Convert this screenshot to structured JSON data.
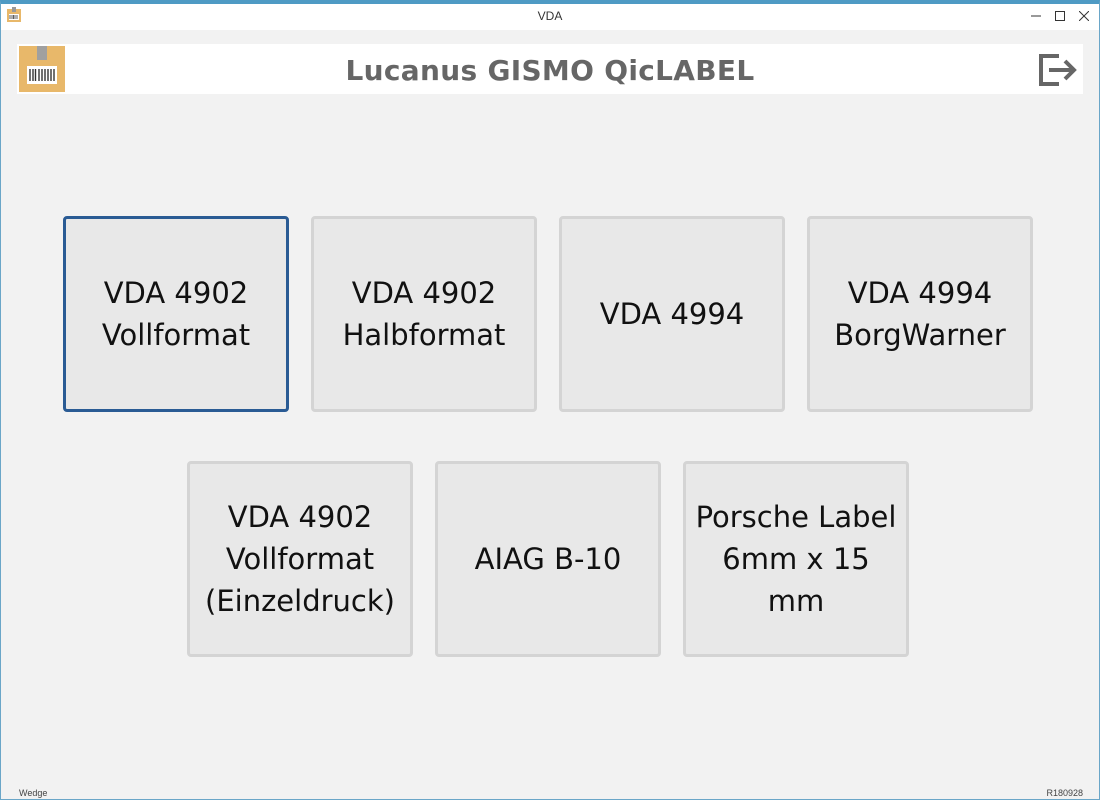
{
  "window": {
    "title": "VDA"
  },
  "header": {
    "title": "Lucanus GISMO QicLABEL",
    "logo_icon": "barcode-box-icon",
    "logout_icon": "logout-icon"
  },
  "tiles": [
    {
      "label": "VDA 4902\nVollformat",
      "selected": true
    },
    {
      "label": "VDA 4902\nHalbformat",
      "selected": false
    },
    {
      "label": "VDA 4994",
      "selected": false
    },
    {
      "label": "VDA 4994\nBorgWarner",
      "selected": false
    },
    {
      "label": "VDA 4902\nVollformat\n(Einzeldruck)",
      "selected": false
    },
    {
      "label": "AIAG B-10",
      "selected": false
    },
    {
      "label": "Porsche Label\n6mm x 15\nmm",
      "selected": false
    }
  ],
  "footer": {
    "left": "Wedge",
    "right": "R180928"
  },
  "colors": {
    "accent_border": "#2a5b94",
    "tile_bg": "#e8e8e8",
    "title_text": "#666666",
    "logo_bg": "#e8b86a"
  }
}
